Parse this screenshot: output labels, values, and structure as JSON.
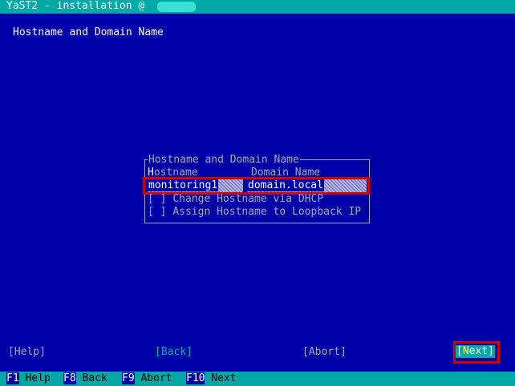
{
  "window": {
    "title": "YaST2 - installation @"
  },
  "dialog": {
    "title": "Hostname and Domain Name",
    "frame_label": "Hostname and Domain Name",
    "hostname_label": "Hostname",
    "domain_label": "Domain Name",
    "hostname_value": "monitoring1",
    "domain_value": "domain.local",
    "checkbox_dhcp": {
      "box": "[ ]",
      "label": "Change Hostname via DHCP",
      "checked": false
    },
    "checkbox_loopback": {
      "box": "[ ]",
      "label": "Assign Hostname to Loopback IP",
      "checked": false
    }
  },
  "buttons": {
    "help": "[Help]",
    "back": "[Back]",
    "abort": "[Abort]",
    "next": "[Next]"
  },
  "function_keys": [
    {
      "key": "F1",
      "label": "Help"
    },
    {
      "key": "F8",
      "label": "Back"
    },
    {
      "key": "F9",
      "label": "Abort"
    },
    {
      "key": "F10",
      "label": "Next"
    }
  ],
  "colors": {
    "background": "#0000a8",
    "accent": "#00a8a8",
    "highlight_box": "#d00000"
  }
}
